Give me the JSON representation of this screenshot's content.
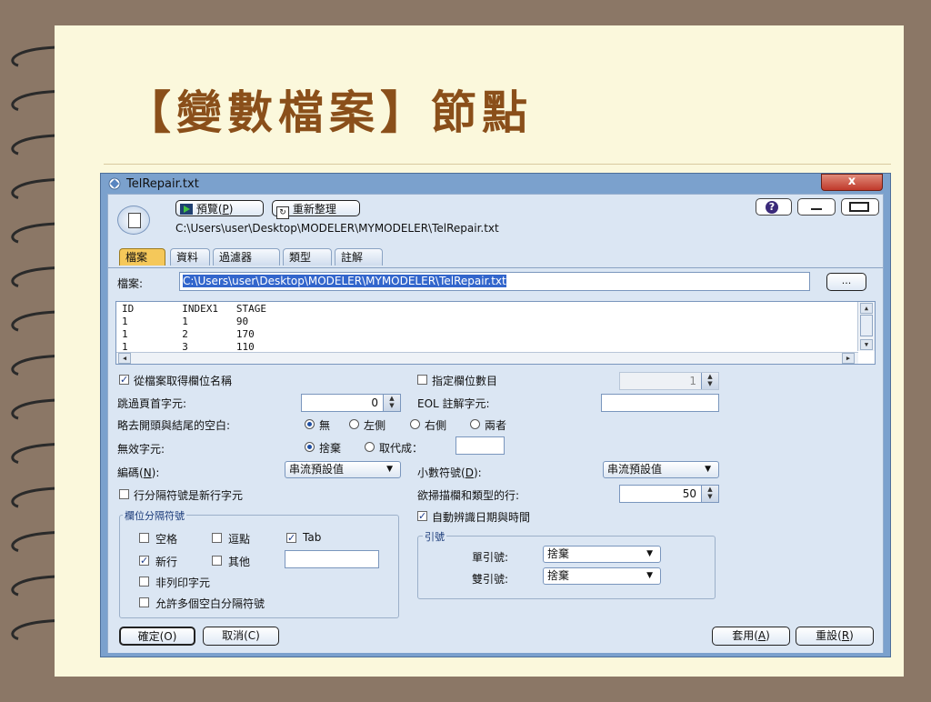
{
  "slide": {
    "title": "【變數檔案】節點"
  },
  "window": {
    "title": "TelRepair.txt",
    "close_label": "x"
  },
  "toolbar": {
    "preview_label": "預覽(",
    "preview_key": "P",
    "preview_close": ")",
    "refresh_label": "重新整理",
    "path": "C:\\Users\\user\\Desktop\\MODELER\\MYMODELER\\TelRepair.txt",
    "help_label": "?"
  },
  "tabs": [
    {
      "label": "檔案",
      "active": true
    },
    {
      "label": "資料",
      "active": false
    },
    {
      "label": "過濾器",
      "active": false
    },
    {
      "label": "類型",
      "active": false
    },
    {
      "label": "註解",
      "active": false
    }
  ],
  "file_section": {
    "label": "檔案:",
    "value": "C:\\Users\\user\\Desktop\\MODELER\\MYMODELER\\TelRepair.txt",
    "browse_label": "..."
  },
  "preview_table": {
    "rows": [
      "ID        INDEX1   STAGE",
      "1         1        90",
      "1         2        170",
      "1         3        110"
    ]
  },
  "options": {
    "get_field_names": {
      "label": "從檔案取得欄位名稱",
      "checked": true
    },
    "specify_field_count": {
      "label": "指定欄位數目",
      "checked": false,
      "value": "1"
    },
    "skip_header_chars": {
      "label": "跳過頁首字元:",
      "value": "0"
    },
    "eol_comment": {
      "label": "EOL 註解字元:",
      "value": ""
    },
    "trim_whitespace": {
      "label": "略去開頭與結尾的空白:",
      "choices": [
        {
          "label": "無",
          "selected": true
        },
        {
          "label": "左側",
          "selected": false
        },
        {
          "label": "右側",
          "selected": false
        },
        {
          "label": "兩者",
          "selected": false
        }
      ]
    },
    "invalid_chars": {
      "label": "無效字元:",
      "discard_label": "捨棄",
      "discard_selected": true,
      "replace_label": "取代成：",
      "replace_selected": false,
      "replace_value": ""
    },
    "encoding": {
      "label": "編碼(",
      "key": "N",
      "close": "):",
      "value": "串流預設值"
    },
    "decimal_symbol": {
      "label": "小數符號(",
      "key": "D",
      "close": "):",
      "value": "串流預設值"
    },
    "line_delimiter_newline": {
      "label": "行分隔符號是新行字元",
      "checked": false
    },
    "scan_rows": {
      "label": "欲掃描欄和類型的行:",
      "value": "50"
    },
    "auto_recognize_dates": {
      "label": "自動辨識日期與時間",
      "checked": true
    }
  },
  "delimiters_group": {
    "title": "欄位分隔符號",
    "space": {
      "label": "空格",
      "checked": false
    },
    "comma": {
      "label": "逗點",
      "checked": false
    },
    "tab": {
      "label": "Tab",
      "checked": true
    },
    "newline": {
      "label": "新行",
      "checked": true
    },
    "other": {
      "label": "其他",
      "checked": false,
      "value": ""
    },
    "non_printing": {
      "label": "非列印字元",
      "checked": false
    },
    "multiple_blanks": {
      "label": "允許多個空白分隔符號",
      "checked": false
    }
  },
  "quotes_group": {
    "title": "引號",
    "single_quote": {
      "label": "單引號:",
      "value": "捨棄"
    },
    "double_quote": {
      "label": "雙引號:",
      "value": "捨棄"
    }
  },
  "buttons": {
    "ok": "確定(O)",
    "cancel": "取消(C)",
    "apply_label": "套用(",
    "apply_key": "A",
    "apply_close": ")",
    "reset_label": "重設(",
    "reset_key": "R",
    "reset_close": ")"
  },
  "colors": {
    "slide_bg": "#fbf8dc",
    "outer_bg": "#8b7766",
    "title": "#8a4f1a",
    "active_tab": "#f5c85a",
    "dialog_frame": "#7ba1cd"
  }
}
